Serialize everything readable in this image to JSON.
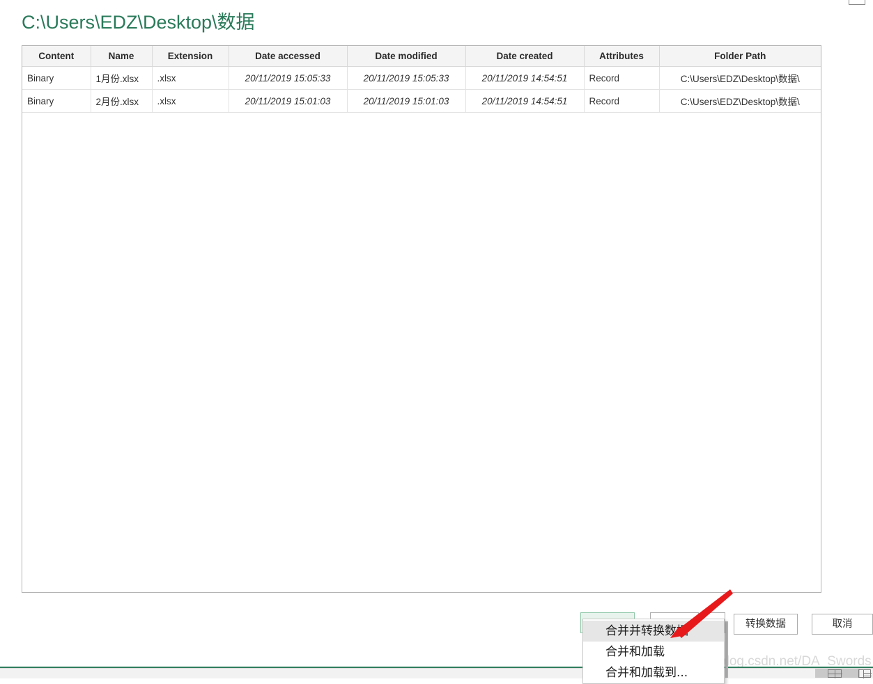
{
  "window": {
    "control_stub": "restore-window-box"
  },
  "title": "C:\\Users\\EDZ\\Desktop\\数据",
  "title_color": "#2a7a5a",
  "table": {
    "columns": [
      "Content",
      "Name",
      "Extension",
      "Date accessed",
      "Date modified",
      "Date created",
      "Attributes",
      "Folder Path"
    ],
    "rows": [
      {
        "content": "Binary",
        "name": "1月份.xlsx",
        "extension": ".xlsx",
        "date_accessed": "20/11/2019 15:05:33",
        "date_modified": "20/11/2019 15:05:33",
        "date_created": "20/11/2019 14:54:51",
        "attributes": "Record",
        "folder_path": "C:\\Users\\EDZ\\Desktop\\数据\\"
      },
      {
        "content": "Binary",
        "name": "2月份.xlsx",
        "extension": ".xlsx",
        "date_accessed": "20/11/2019 15:01:03",
        "date_modified": "20/11/2019 15:01:03",
        "date_created": "20/11/2019 14:54:51",
        "attributes": "Record",
        "folder_path": "C:\\Users\\EDZ\\Desktop\\数据\\"
      }
    ]
  },
  "buttons": {
    "combine_label": "",
    "combine_arrow_label": "",
    "load_label": "",
    "transform_data_label": "转换数据",
    "cancel_label": "取消"
  },
  "combine_menu": {
    "items": [
      {
        "label": "合并并转换数据",
        "selected": true
      },
      {
        "label": "合并和加载",
        "selected": false
      },
      {
        "label": "合并和加载到...",
        "selected": false
      }
    ]
  },
  "annotation": {
    "arrow_color": "#e8191b"
  },
  "watermark": "https://blog.csdn.net/DA_Swords_Man",
  "status_bar": {
    "accent_color": "#2f7d5d",
    "view_icons": [
      "normal-view-icon",
      "page-layout-icon"
    ]
  }
}
